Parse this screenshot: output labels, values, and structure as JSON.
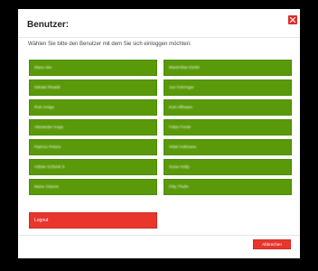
{
  "dialog": {
    "title": "Benutzer:",
    "close_icon": "close-icon",
    "instruction": "Wählen Sie bitte den Benutzer mit dem Sie sich einloggen möchten:",
    "users": [
      "Mara Aka",
      "Maximilian Einfel",
      "Nikolai Rinaldi",
      "Joe Fehringer",
      "Rob Amigo",
      "Kurt Affmann",
      "Alexander Kopp",
      "Fabio Forde",
      "Patricio Peters",
      "Vidal Holtmann",
      "Adrian Schünk S",
      "Gusa Holtp",
      "Marie Giaone",
      "Filip Thulin"
    ],
    "logout_label": "Logout",
    "cancel_label": "Abbrechen"
  },
  "colors": {
    "user_button": "#5a9a0a",
    "logout_button": "#e8362d",
    "cancel_button": "#e8362d",
    "close_button": "#e02b27",
    "overlay": "#000000"
  }
}
